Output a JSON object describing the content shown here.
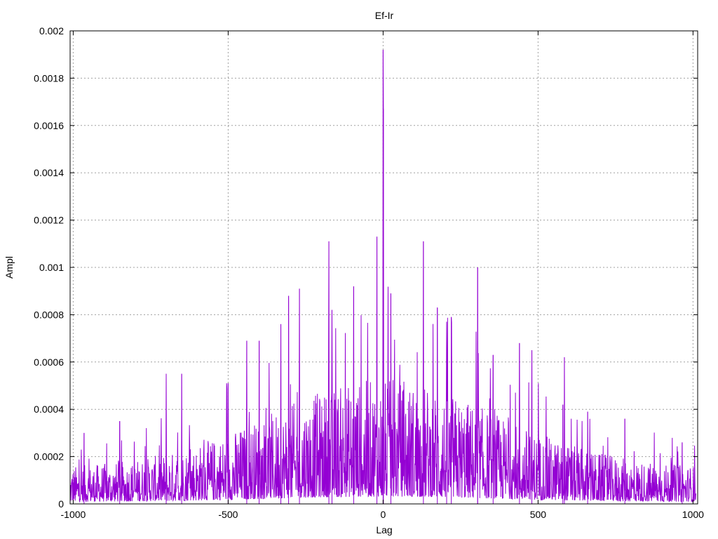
{
  "chart_data": {
    "type": "line",
    "title": "Ef-Ir",
    "xlabel": "Lag",
    "ylabel": "Ampl",
    "xlim": [
      -1010,
      1015
    ],
    "ylim": [
      0,
      0.002
    ],
    "x_ticks": [
      -1000,
      -500,
      0,
      500,
      1000
    ],
    "x_tick_labels": [
      "-1000",
      "-500",
      "0",
      "500",
      "1000"
    ],
    "y_ticks": [
      0,
      0.0002,
      0.0004,
      0.0006,
      0.0008,
      0.001,
      0.0012,
      0.0014,
      0.0016,
      0.0018,
      0.002
    ],
    "y_tick_labels": [
      "0",
      "0.0002",
      "0.0004",
      "0.0006",
      "0.0008",
      "0.001",
      "0.0012",
      "0.0014",
      "0.0016",
      "0.0018",
      "0.002"
    ],
    "grid": true,
    "series": [
      {
        "color": "#9400d3",
        "peaks": [
          {
            "x": 0,
            "y": 0.00192
          },
          {
            "x": 1,
            "y": 0.00167
          },
          {
            "x": -20,
            "y": 0.00113
          },
          {
            "x": -175,
            "y": 0.00111
          },
          {
            "x": 130,
            "y": 0.00111
          },
          {
            "x": 305,
            "y": 0.001
          },
          {
            "x": -270,
            "y": 0.00091
          },
          {
            "x": -305,
            "y": 0.00088
          },
          {
            "x": -95,
            "y": 0.00092
          },
          {
            "x": 25,
            "y": 0.00089
          },
          {
            "x": -165,
            "y": 0.00082
          },
          {
            "x": 175,
            "y": 0.00083
          },
          {
            "x": 220,
            "y": 0.00079
          },
          {
            "x": 205,
            "y": 0.00077
          },
          {
            "x": -330,
            "y": 0.00076
          },
          {
            "x": -400,
            "y": 0.00069
          },
          {
            "x": -440,
            "y": 0.00069
          },
          {
            "x": 440,
            "y": 0.00068
          },
          {
            "x": 480,
            "y": 0.00065
          },
          {
            "x": 355,
            "y": 0.00063
          },
          {
            "x": 585,
            "y": 0.00062
          },
          {
            "x": 305,
            "y": 0.00069
          },
          {
            "x": -500,
            "y": 0.00051
          },
          {
            "x": -650,
            "y": 0.00055
          },
          {
            "x": -700,
            "y": 0.00055
          },
          {
            "x": -850,
            "y": 0.00035
          },
          {
            "x": -965,
            "y": 0.0003
          },
          {
            "x": 580,
            "y": 0.00042
          },
          {
            "x": 660,
            "y": 0.00039
          },
          {
            "x": 780,
            "y": 0.00036
          },
          {
            "x": 965,
            "y": 0.00026
          }
        ]
      }
    ]
  }
}
